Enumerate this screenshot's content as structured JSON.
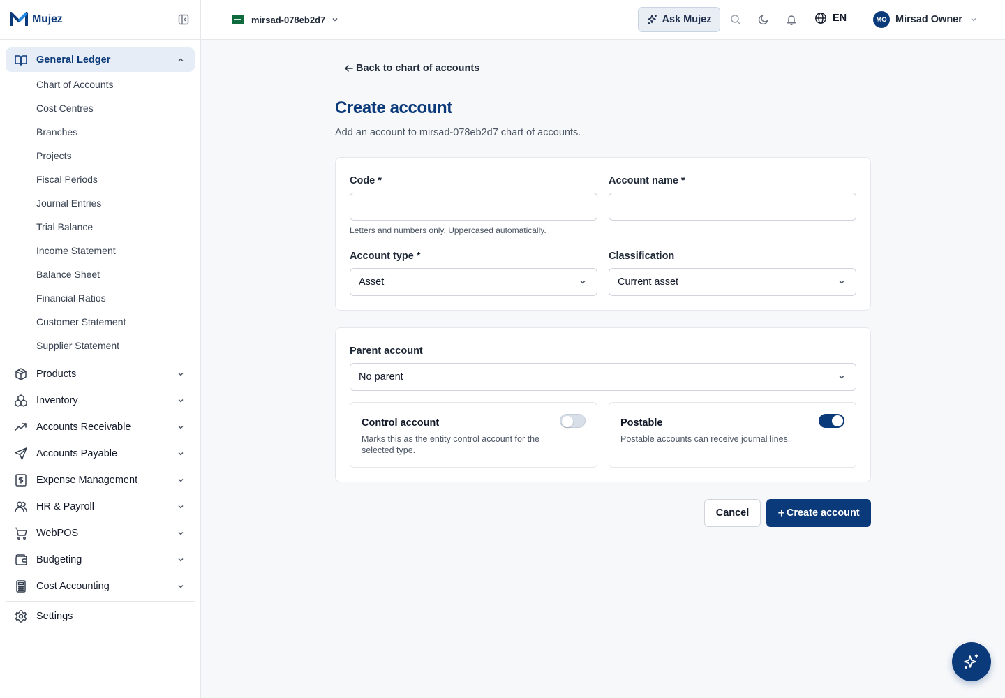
{
  "brand": {
    "name": "Mujez"
  },
  "sidebar": {
    "active_group": {
      "label": "General Ledger",
      "icon": "book-open-icon"
    },
    "sub_items": [
      "Chart of Accounts",
      "Cost Centres",
      "Branches",
      "Projects",
      "Fiscal Periods",
      "Journal Entries",
      "Trial Balance",
      "Income Statement",
      "Balance Sheet",
      "Financial Ratios",
      "Customer Statement",
      "Supplier Statement"
    ],
    "groups": [
      {
        "label": "Products",
        "icon": "box-icon"
      },
      {
        "label": "Inventory",
        "icon": "boxes-icon"
      },
      {
        "label": "Accounts Receivable",
        "icon": "trending-up-icon"
      },
      {
        "label": "Accounts Payable",
        "icon": "send-icon"
      },
      {
        "label": "Expense Management",
        "icon": "receipt-dollar-icon"
      },
      {
        "label": "HR & Payroll",
        "icon": "users-icon"
      },
      {
        "label": "WebPOS",
        "icon": "cart-icon"
      },
      {
        "label": "Budgeting",
        "icon": "wallet-icon"
      },
      {
        "label": "Cost Accounting",
        "icon": "calculator-icon"
      }
    ],
    "settings": {
      "label": "Settings",
      "icon": "gear-icon"
    }
  },
  "topbar": {
    "org": "mirsad-078eb2d7",
    "ask_label": "Ask Mujez",
    "lang": "EN",
    "user_initials": "MO",
    "user_name": "Mirsad Owner"
  },
  "page": {
    "back_label": "Back to chart of accounts",
    "title": "Create account",
    "subtitle": "Add an account to mirsad-078eb2d7 chart of accounts."
  },
  "form": {
    "code_label": "Code *",
    "code_value": "",
    "code_hint": "Letters and numbers only. Uppercased automatically.",
    "name_label": "Account name *",
    "name_value": "",
    "type_label": "Account type *",
    "type_value": "Asset",
    "class_label": "Classification",
    "class_value": "Current asset",
    "parent_label": "Parent account",
    "parent_value": "No parent",
    "control": {
      "title": "Control account",
      "desc": "Marks this as the entity control account for the selected type.",
      "on": false
    },
    "postable": {
      "title": "Postable",
      "desc": "Postable accounts can receive journal lines.",
      "on": true
    }
  },
  "actions": {
    "cancel": "Cancel",
    "create": "Create account"
  },
  "colors": {
    "primary": "#0b3a7a",
    "accent_blue": "#1e88e5"
  }
}
